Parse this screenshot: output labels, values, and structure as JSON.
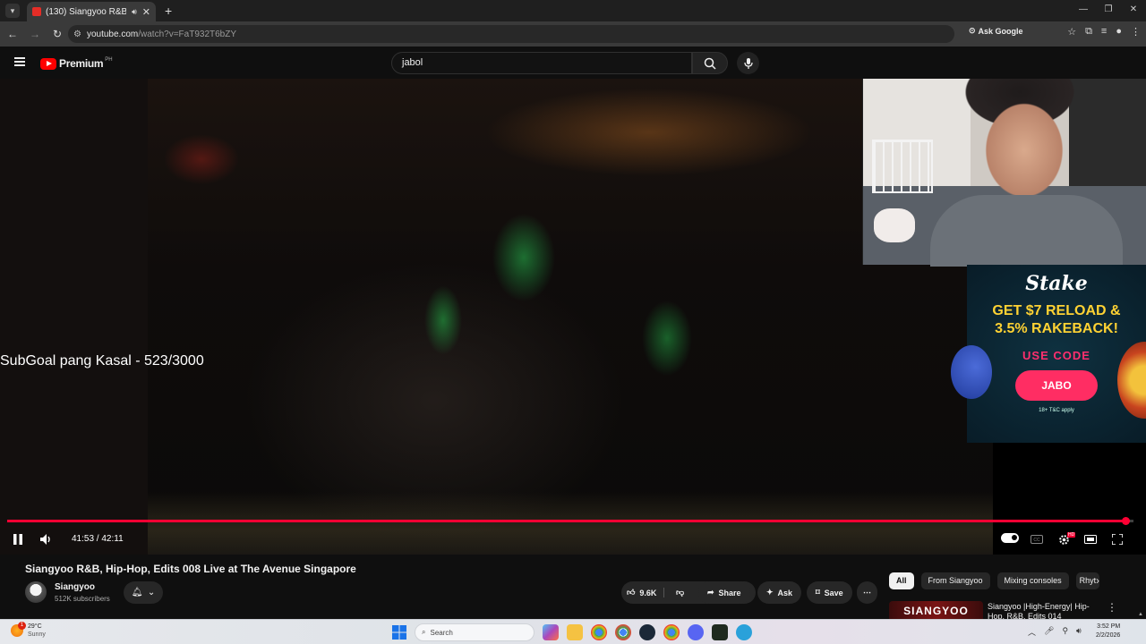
{
  "browser": {
    "tab_title": "(130) Siangyoo R&B, Hip-H",
    "url_host": "youtube.com",
    "url_path": "/watch?v=FaT932T6bZY",
    "ask_google": "Ask Google"
  },
  "youtube": {
    "logo_text": "Premium",
    "country_code": "PH",
    "search_value": "jabol"
  },
  "video": {
    "overlay_text": "SubGoal pang Kasal - 523/3000",
    "current_time": "41:53",
    "duration": "42:11",
    "time_display": "41:53 / 42:11",
    "progress_fraction": 0.9929,
    "hd_badge": "HD"
  },
  "ad": {
    "brand": "Stake",
    "headline_1": "GET $7 RELOAD &",
    "headline_2": "3.5% RAKEBACK!",
    "use_code": "USE CODE",
    "code": "JABO",
    "terms": "18+  T&C apply"
  },
  "details": {
    "title": "Siangyoo R&B, Hip-Hop, Edits 008 Live at The Avenue Singapore",
    "channel": "Siangyoo",
    "subscribers": "512K subscribers",
    "likes": "9.6K",
    "share": "Share",
    "ask": "Ask",
    "save": "Save"
  },
  "chips": [
    "All",
    "From Siangyoo",
    "Mixing consoles",
    "Rhyt"
  ],
  "recommended": {
    "thumb_text": "SIANGYOO",
    "title": "Siangyoo |High-Energy| Hip-Hop, R&B, Edits 014"
  },
  "taskbar": {
    "temperature": "29°C",
    "condition": "Sunny",
    "weather_badge": "1",
    "search_placeholder": "Search",
    "time": "3:52 PM",
    "date": "2/2/2026"
  },
  "colors": {
    "accent": "#ff0033",
    "ad_code_button": "#ff2d63",
    "ad_headline": "#ffd233"
  }
}
